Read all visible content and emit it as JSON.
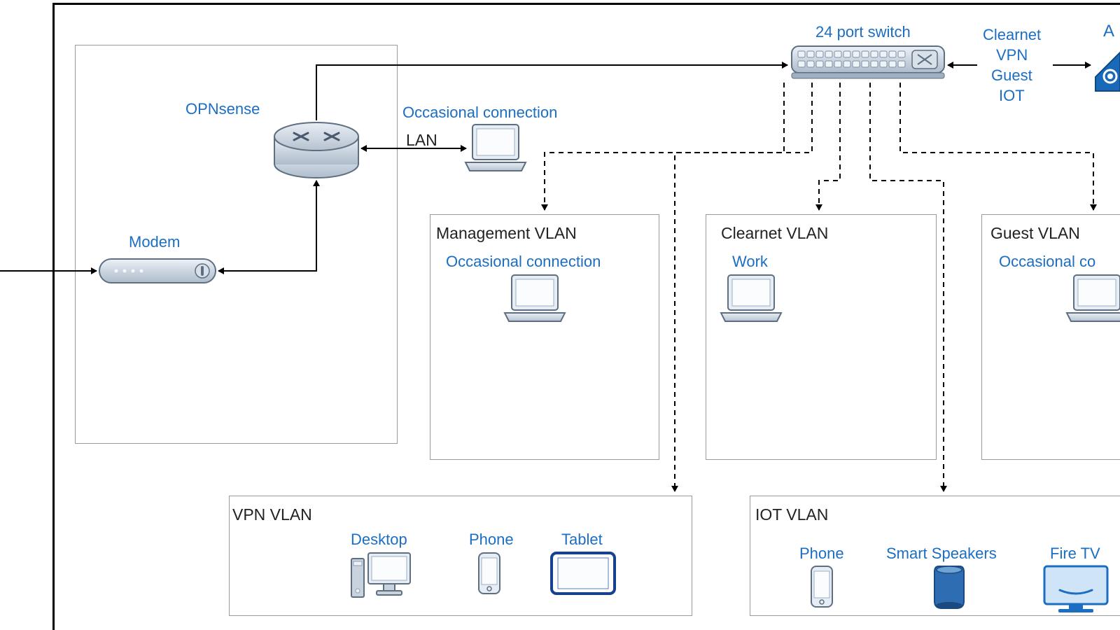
{
  "nodes": {
    "opnsense_label": "OPNsense",
    "modem_label": "Modem",
    "switch_label": "24 port switch",
    "switch_side_labels": [
      "Clearnet",
      "VPN",
      "Guest",
      "IOT"
    ],
    "ap_label_partial": "A",
    "lan_label": "LAN",
    "occasional": "Occasional connection",
    "occasional_partial": "Occasional co",
    "work": "Work"
  },
  "groups": {
    "mgmt": "Management VLAN",
    "clearnet": "Clearnet VLAN",
    "guest": "Guest VLAN",
    "vpn": "VPN VLAN",
    "iot": "IOT VLAN"
  },
  "vpn_devices": {
    "desktop": "Desktop",
    "phone": "Phone",
    "tablet": "Tablet"
  },
  "iot_devices": {
    "phone": "Phone",
    "speakers": "Smart Speakers",
    "firetv": "Fire TV"
  }
}
